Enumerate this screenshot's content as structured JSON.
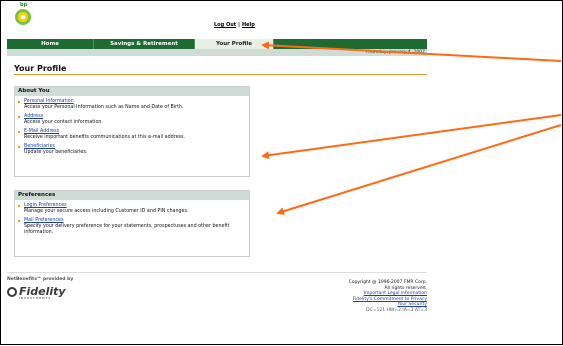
{
  "logo": {
    "brand_text": "bp"
  },
  "top_links": {
    "logout": "Log Out",
    "separator": "|",
    "help": "Help"
  },
  "nav": {
    "tabs": [
      {
        "label": "Home"
      },
      {
        "label": "Savings & Retirement"
      },
      {
        "label": "Your Profile",
        "active": true
      }
    ],
    "date": "Thursday, January 4, 2007"
  },
  "page": {
    "title": "Your Profile"
  },
  "about": {
    "heading": "About You",
    "items": [
      {
        "link": "Personal Information",
        "desc": "Access your Personal Information such as Name and Date of Birth."
      },
      {
        "link": "Address",
        "desc": "Access your contact information."
      },
      {
        "link": "E-Mail Address",
        "desc": "Receive important benefits communications at this e-mail address."
      },
      {
        "link": "Beneficiaries",
        "desc": "Update your beneficiaries."
      }
    ]
  },
  "preferences": {
    "heading": "Preferences",
    "items": [
      {
        "link": "Login Preferences",
        "desc": "Manage your secure access including Customer ID and PIN changes."
      },
      {
        "link": "Mail Preferences",
        "desc": "Specify your delivery preference for your statements, prospectuses and other benefit information."
      }
    ]
  },
  "footer": {
    "provided_by": "NetBenefits℠ provided by",
    "fidelity_word": "Fidelity",
    "fidelity_sub": "INVESTMENTS",
    "copyright": "Copyright @ 1996-2007 FMR Corp.",
    "rights": "All rights reserved.",
    "legal_link": "Important Legal Information",
    "privacy_link": "Fidelity's Commitment to Privacy",
    "security_link": "Your Security",
    "codes": "DC=121 HW=2 IA=3 AT=3"
  },
  "colors": {
    "nav_green": "#1d6b32",
    "band": "#cfdbd5",
    "arrow": "#ff6a13",
    "rule": "#e0a030",
    "link": "#1c3fa8"
  }
}
